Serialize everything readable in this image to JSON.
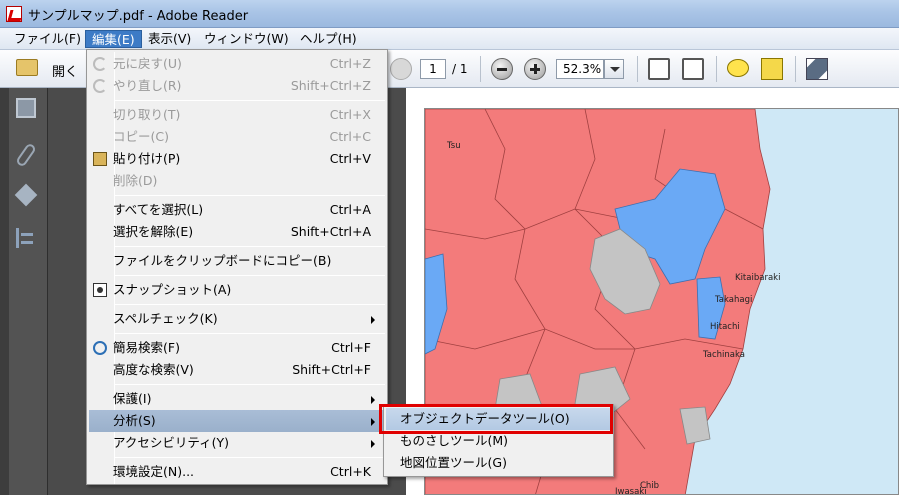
{
  "window": {
    "title": "サンプルマップ.pdf - Adobe Reader"
  },
  "menubar": [
    {
      "label": "ファイル(F)"
    },
    {
      "label": "編集(E)"
    },
    {
      "label": "表示(V)"
    },
    {
      "label": "ウィンドウ(W)"
    },
    {
      "label": "ヘルプ(H)"
    }
  ],
  "toolbar": {
    "open_label": "開く",
    "page_current": "1",
    "page_total": "/ 1",
    "zoom": "52.3%"
  },
  "edit_menu": {
    "items": [
      {
        "label": "元に戻す(U)",
        "shortcut": "Ctrl+Z"
      },
      {
        "label": "やり直し(R)",
        "shortcut": "Shift+Ctrl+Z"
      },
      {
        "label": "切り取り(T)",
        "shortcut": "Ctrl+X"
      },
      {
        "label": "コピー(C)",
        "shortcut": "Ctrl+C"
      },
      {
        "label": "貼り付け(P)",
        "shortcut": "Ctrl+V"
      },
      {
        "label": "削除(D)",
        "shortcut": ""
      },
      {
        "label": "すべてを選択(L)",
        "shortcut": "Ctrl+A"
      },
      {
        "label": "選択を解除(E)",
        "shortcut": "Shift+Ctrl+A"
      },
      {
        "label": "ファイルをクリップボードにコピー(B)",
        "shortcut": ""
      },
      {
        "label": "スナップショット(A)",
        "shortcut": ""
      },
      {
        "label": "スペルチェック(K)",
        "shortcut": ""
      },
      {
        "label": "簡易検索(F)",
        "shortcut": "Ctrl+F"
      },
      {
        "label": "高度な検索(V)",
        "shortcut": "Shift+Ctrl+F"
      },
      {
        "label": "保護(I)",
        "shortcut": ""
      },
      {
        "label": "分析(S)",
        "shortcut": ""
      },
      {
        "label": "アクセシビリティ(Y)",
        "shortcut": ""
      },
      {
        "label": "環境設定(N)...",
        "shortcut": "Ctrl+K"
      }
    ]
  },
  "analysis_submenu": {
    "items": [
      {
        "label": "オブジェクトデータツール(O)"
      },
      {
        "label": "ものさしツール(M)"
      },
      {
        "label": "地図位置ツール(G)"
      }
    ]
  },
  "map": {
    "labels": [
      "Tsu",
      "Kitaibaraki",
      "Takahagi",
      "Hitachi",
      "Tachinaka",
      "Chib",
      "Iwasaki"
    ],
    "colors": {
      "red": "#f37b7b",
      "blue": "#6aa9f5",
      "gray": "#c4c4c4",
      "sea": "#cfe8f6"
    }
  }
}
